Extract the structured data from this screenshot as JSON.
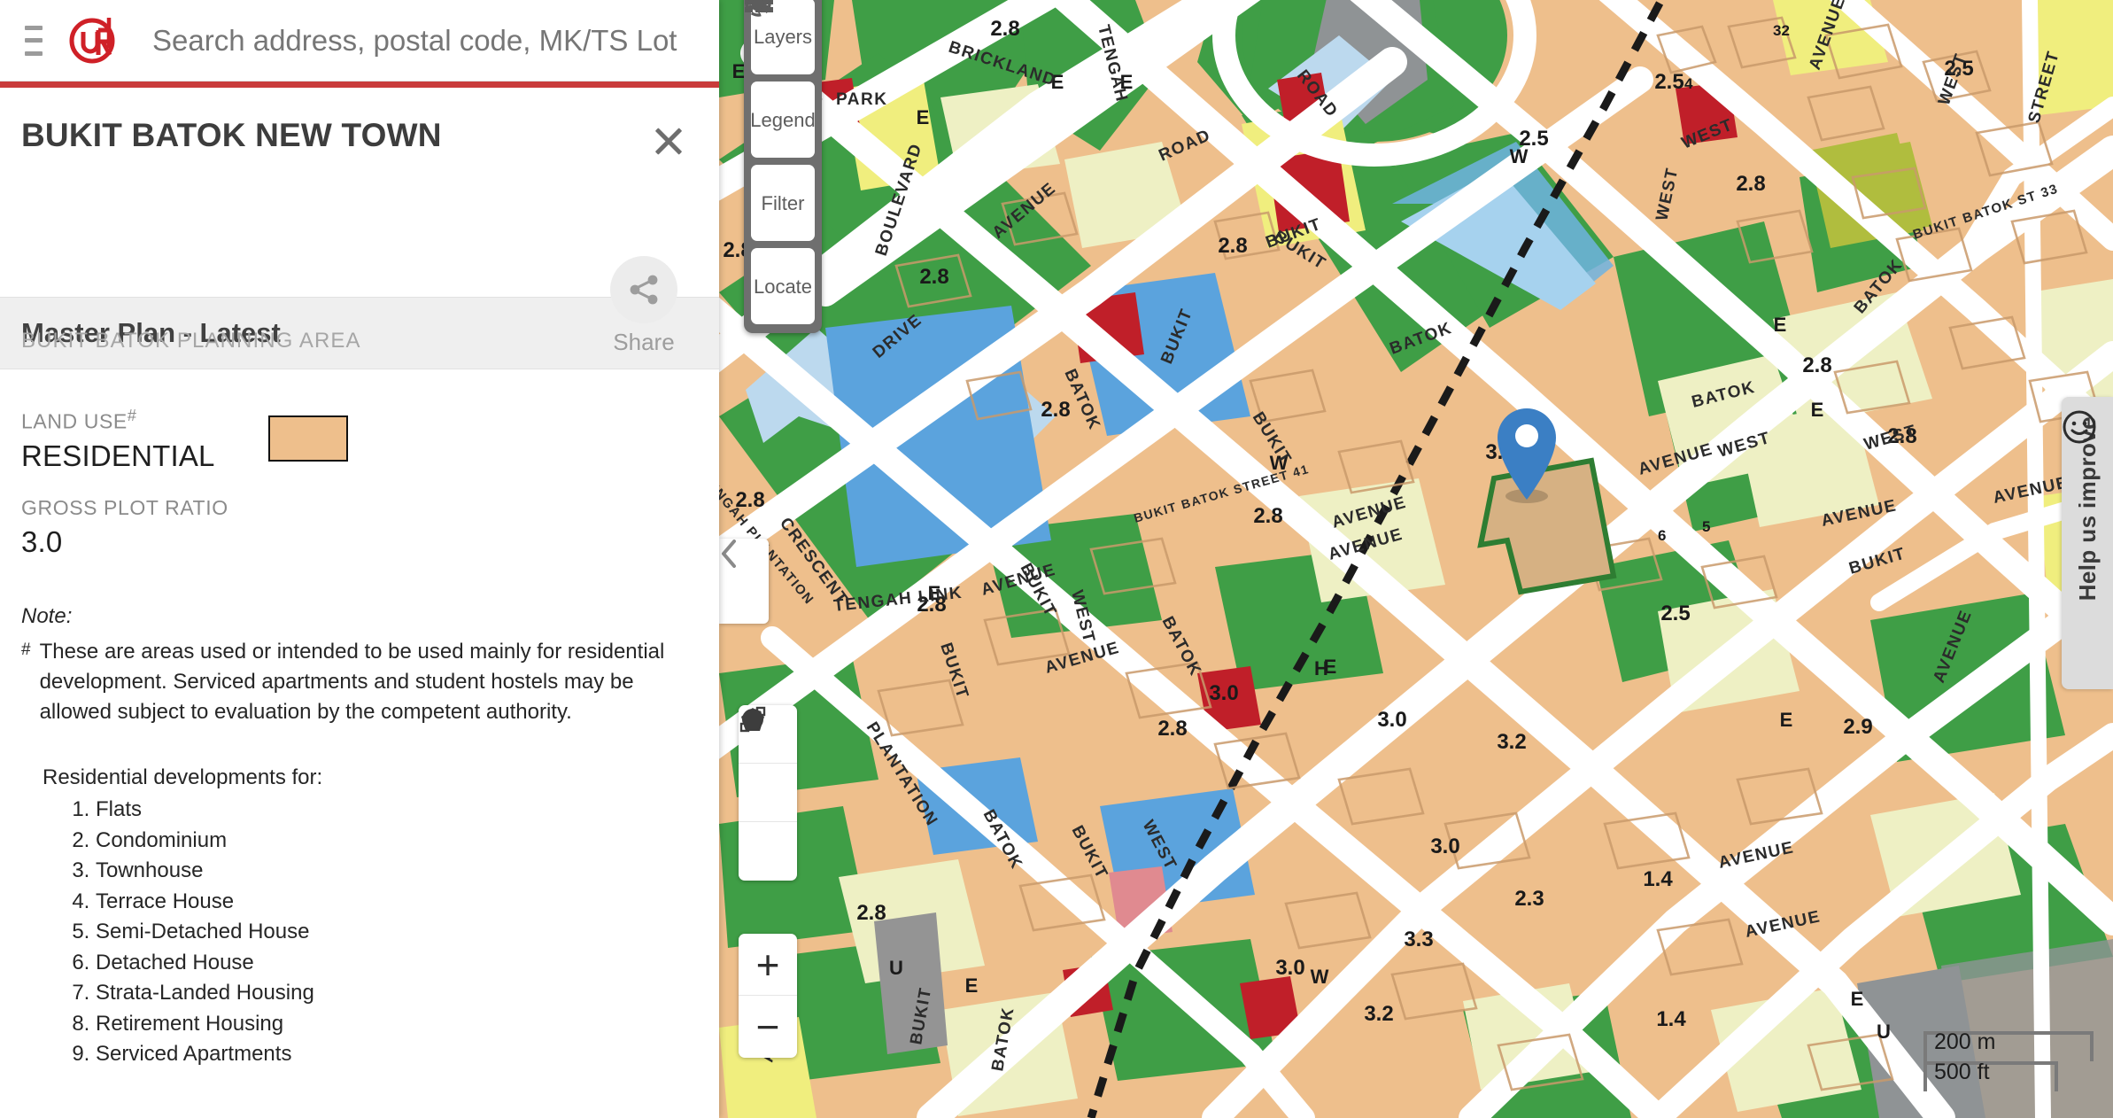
{
  "header": {
    "menu_icon": "hamburger-icon",
    "logo_text": "URA",
    "search_placeholder": "Search address, postal code, MK/TS Lot",
    "search_value": "",
    "clear_icon": "close-icon"
  },
  "panel": {
    "title": "BUKIT BATOK NEW TOWN",
    "close_icon": "close-icon",
    "share_icon": "share-icon",
    "share_label": "Share",
    "subarea": "BUKIT BATOK PLANNING AREA",
    "plan_label": "Master Plan - Latest",
    "attributes": {
      "land_use_key": "LAND USE",
      "land_use_marker": "#",
      "land_use_value": "RESIDENTIAL",
      "land_use_color": "#eebf8c",
      "gpr_key": "GROSS PLOT RATIO",
      "gpr_value": "3.0"
    },
    "note_title": "Note:",
    "note_marker": "#",
    "note_text": "These are areas used or intended to be used mainly for residential development. Serviced apartments and student hostels may be allowed subject to evaluation by the competent authority.",
    "dev_heading": "Residential developments for:",
    "dev_list": [
      "Flats",
      "Condominium",
      "Townhouse",
      "Terrace House",
      "Semi-Detached House",
      "Detached House",
      "Strata-Landed Housing",
      "Retirement Housing",
      "Serviced Apartments"
    ]
  },
  "map_toolbar": [
    {
      "label": "Layers",
      "icon": "layers-icon"
    },
    {
      "label": "Legend",
      "icon": "legend-icon"
    },
    {
      "label": "Filter",
      "icon": "filter-icon"
    },
    {
      "label": "Locate",
      "icon": "locate-icon"
    }
  ],
  "draw_tools": [
    {
      "icon": "measure-line-icon"
    },
    {
      "icon": "polygon-icon"
    },
    {
      "icon": "circle-icon"
    }
  ],
  "zoom_controls": {
    "zoom_in": "+",
    "zoom_out": "−"
  },
  "collapse_handle": {
    "icon": "chevron-left-icon"
  },
  "help": {
    "label": "Help us improve",
    "icon": "smiley-icon"
  },
  "scalebar": {
    "metric": "200 m",
    "imperial": "500 ft"
  },
  "map": {
    "colors": {
      "residential": "#eebf8c",
      "open_space": "#3f9e46",
      "park_dark": "#3f9e46",
      "waterbody": "#5ba3dd",
      "institution": "#eef0c4",
      "business": "#f0ee7e",
      "business_park": "#b0bd3e",
      "reserve": "#8f9395",
      "place_of_worship": "#c01f29",
      "transport": "#949494",
      "commercial": "#e08a90",
      "road": "#ffffff",
      "selected_outline": "#2e7d32",
      "marker": "#3b7fc4"
    },
    "gpr_labels": [
      "2.8",
      "2.5",
      "2.8",
      "2.8",
      "2.8",
      "2.8",
      "2.8",
      "2.8",
      "2.8",
      "2.5",
      "2.8",
      "2.8",
      "2.8",
      "3.0",
      "2.5",
      "2.8",
      "3.0",
      "3.2",
      "3.0",
      "3.0",
      "3.3",
      "2.3",
      "2.9",
      "1.4",
      "3.0",
      "2.8",
      "3.2",
      "1.4",
      "2.5",
      "2.8",
      "2.8"
    ],
    "letter_labels": [
      "E",
      "E",
      "E",
      "E",
      "E",
      "E",
      "E",
      "W",
      "W",
      "W",
      "W",
      "W",
      "H",
      "U",
      "U"
    ],
    "road_labels": [
      "BRICKLAND",
      "ROAD",
      "ROAD",
      "TENGAH",
      "PARK",
      "AVENUE",
      "BOULEVARD",
      "DRIVE",
      "BUKIT",
      "BATOK",
      "BUKIT",
      "BATOK",
      "WEST",
      "AVENUE",
      "WEST",
      "AVENUE",
      "BUKIT",
      "BATOK",
      "WEST",
      "AVENUE",
      "BATOK",
      "PLANTATION",
      "CRESCENT",
      "TENGAH LINK",
      "TENGAH PLANTATION CRESCENT",
      "BUKIT",
      "BUKIT BATOK ST 33",
      "BUKIT BATOK STREET 41",
      "WEST",
      "AVENUE",
      "STREET",
      "BATOK",
      "AVENUE"
    ],
    "selected_parcel_gpr": "3.0"
  }
}
